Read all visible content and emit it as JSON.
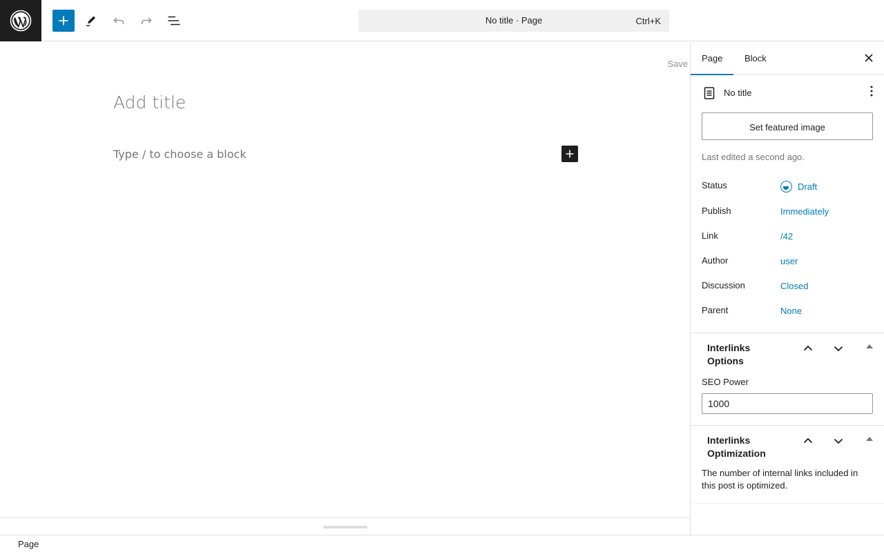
{
  "topbar": {
    "command_title": "No title · Page",
    "command_shortcut": "Ctrl+K"
  },
  "editor": {
    "save_label": "Save",
    "title_placeholder": "Add title",
    "block_placeholder": "Type / to choose a block"
  },
  "footer": {
    "breadcrumb": "Page"
  },
  "sidebar": {
    "tabs": [
      "Page",
      "Block"
    ],
    "post": {
      "title": "No title"
    },
    "featured_image_label": "Set featured image",
    "last_edited": "Last edited a second ago.",
    "meta": [
      {
        "label": "Status",
        "value": "Draft"
      },
      {
        "label": "Publish",
        "value": "Immediately"
      },
      {
        "label": "Link",
        "value": "/42"
      },
      {
        "label": "Author",
        "value": "user"
      },
      {
        "label": "Discussion",
        "value": "Closed"
      },
      {
        "label": "Parent",
        "value": "None"
      }
    ],
    "interlinks_options": {
      "title": "Interlinks Options",
      "seo_power_label": "SEO Power",
      "seo_power_value": "1000"
    },
    "interlinks_optimization": {
      "title": "Interlinks Optimization",
      "text": "The number of internal links included in this post is optimized."
    }
  },
  "colors": {
    "accent": "#007cba",
    "dark": "#1e1e1e"
  }
}
